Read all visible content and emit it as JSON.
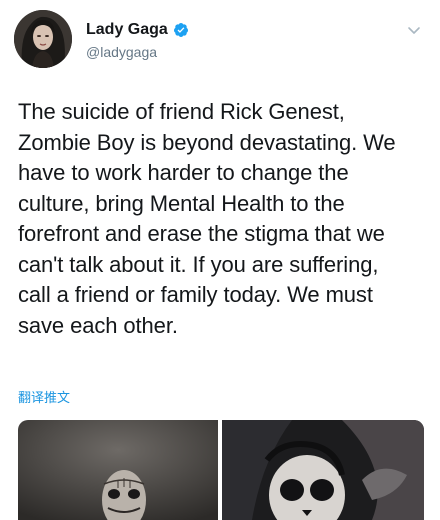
{
  "tweet": {
    "author": {
      "display_name": "Lady Gaga",
      "handle": "@ladygaga",
      "verified": true,
      "avatar_icon": "avatar-portrait"
    },
    "menu_icon": "chevron-down-icon",
    "text": "The suicide of friend Rick Genest,\nZombie Boy is beyond devastating. We\nhave to work harder to change the\nculture, bring Mental Health to the\nforefront and erase the stigma that we\ncan't talk about it. If you are suffering,\ncall a friend or family today. We must\nsave each other.",
    "translate_label": "翻译推文",
    "media": [
      {
        "name": "photo-tattooed-man"
      },
      {
        "name": "photo-skull-face"
      }
    ]
  },
  "colors": {
    "text": "#14171a",
    "secondary": "#657786",
    "link": "#1b95e0",
    "verified": "#1da1f2"
  }
}
